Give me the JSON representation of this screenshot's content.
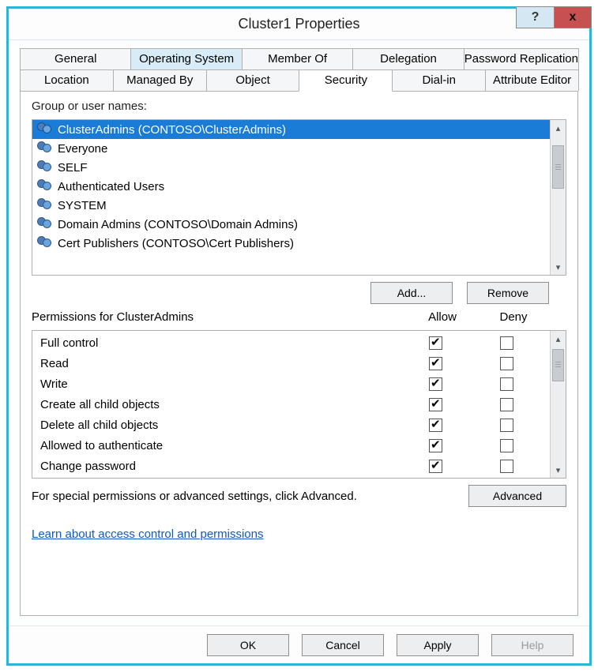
{
  "window": {
    "title": "Cluster1 Properties"
  },
  "titlebar_buttons": {
    "help": "?",
    "close": "x"
  },
  "tabs_row1": [
    {
      "label": "General",
      "highlight": false,
      "active": false
    },
    {
      "label": "Operating System",
      "highlight": true,
      "active": false
    },
    {
      "label": "Member Of",
      "highlight": false,
      "active": false
    },
    {
      "label": "Delegation",
      "highlight": false,
      "active": false
    },
    {
      "label": "Password Replication",
      "highlight": false,
      "active": false
    }
  ],
  "tabs_row2": [
    {
      "label": "Location",
      "highlight": false,
      "active": false
    },
    {
      "label": "Managed By",
      "highlight": false,
      "active": false
    },
    {
      "label": "Object",
      "highlight": false,
      "active": false
    },
    {
      "label": "Security",
      "highlight": false,
      "active": true
    },
    {
      "label": "Dial-in",
      "highlight": false,
      "active": false
    },
    {
      "label": "Attribute Editor",
      "highlight": false,
      "active": false
    }
  ],
  "group_list": {
    "label": "Group or user names:",
    "items": [
      {
        "name": "ClusterAdmins (CONTOSO\\ClusterAdmins)",
        "selected": true
      },
      {
        "name": "Everyone",
        "selected": false
      },
      {
        "name": "SELF",
        "selected": false
      },
      {
        "name": "Authenticated Users",
        "selected": false
      },
      {
        "name": "SYSTEM",
        "selected": false
      },
      {
        "name": "Domain Admins (CONTOSO\\Domain Admins)",
        "selected": false
      },
      {
        "name": "Cert Publishers (CONTOSO\\Cert Publishers)",
        "selected": false
      }
    ]
  },
  "buttons": {
    "add": "Add...",
    "remove": "Remove",
    "advanced": "Advanced",
    "ok": "OK",
    "cancel": "Cancel",
    "apply": "Apply",
    "help": "Help"
  },
  "permissions": {
    "header_label": "Permissions for ClusterAdmins",
    "col_allow": "Allow",
    "col_deny": "Deny",
    "rows": [
      {
        "name": "Full control",
        "allow": true,
        "deny": false
      },
      {
        "name": "Read",
        "allow": true,
        "deny": false
      },
      {
        "name": "Write",
        "allow": true,
        "deny": false
      },
      {
        "name": "Create all child objects",
        "allow": true,
        "deny": false
      },
      {
        "name": "Delete all child objects",
        "allow": true,
        "deny": false
      },
      {
        "name": "Allowed to authenticate",
        "allow": true,
        "deny": false
      },
      {
        "name": "Change password",
        "allow": true,
        "deny": false
      }
    ]
  },
  "footer": {
    "special_text": "For special permissions or advanced settings, click Advanced.",
    "link_text": "Learn about access control and permissions"
  }
}
